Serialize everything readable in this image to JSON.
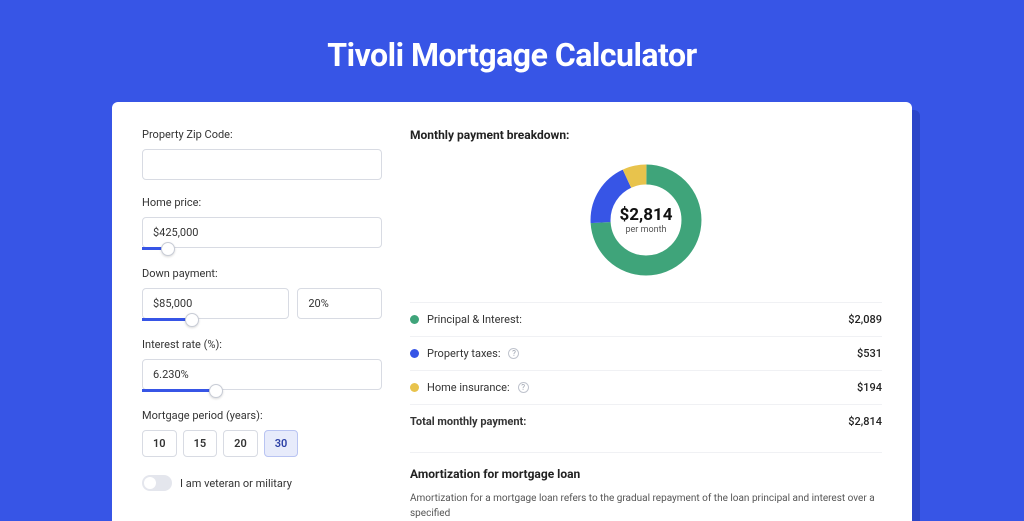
{
  "title": "Tivoli Mortgage Calculator",
  "form": {
    "zip_label": "Property Zip Code:",
    "zip_value": "",
    "home_price_label": "Home price:",
    "home_price_value": "$425,000",
    "down_payment_label": "Down payment:",
    "down_payment_value": "$85,000",
    "down_payment_pct": "20%",
    "interest_label": "Interest rate (%):",
    "interest_value": "6.230%",
    "period_label": "Mortgage period (years):",
    "periods": [
      "10",
      "15",
      "20",
      "30"
    ],
    "period_selected": "30",
    "veteran_label": "I am veteran or military"
  },
  "breakdown": {
    "title": "Monthly payment breakdown:",
    "center_amount": "$2,814",
    "center_sub": "per month",
    "rows": [
      {
        "label": "Principal & Interest:",
        "value": "$2,089",
        "color": "green",
        "info": false
      },
      {
        "label": "Property taxes:",
        "value": "$531",
        "color": "blue",
        "info": true
      },
      {
        "label": "Home insurance:",
        "value": "$194",
        "color": "yellow",
        "info": true
      }
    ],
    "total_label": "Total monthly payment:",
    "total_value": "$2,814"
  },
  "amortization": {
    "title": "Amortization for mortgage loan",
    "text": "Amortization for a mortgage loan refers to the gradual repayment of the loan principal and interest over a specified"
  },
  "chart_data": {
    "type": "pie",
    "title": "Monthly payment breakdown",
    "series": [
      {
        "name": "Principal & Interest",
        "value": 2089,
        "color": "#3fa47a"
      },
      {
        "name": "Property taxes",
        "value": 531,
        "color": "#3755e6"
      },
      {
        "name": "Home insurance",
        "value": 194,
        "color": "#e8c34c"
      }
    ],
    "total": 2814
  }
}
